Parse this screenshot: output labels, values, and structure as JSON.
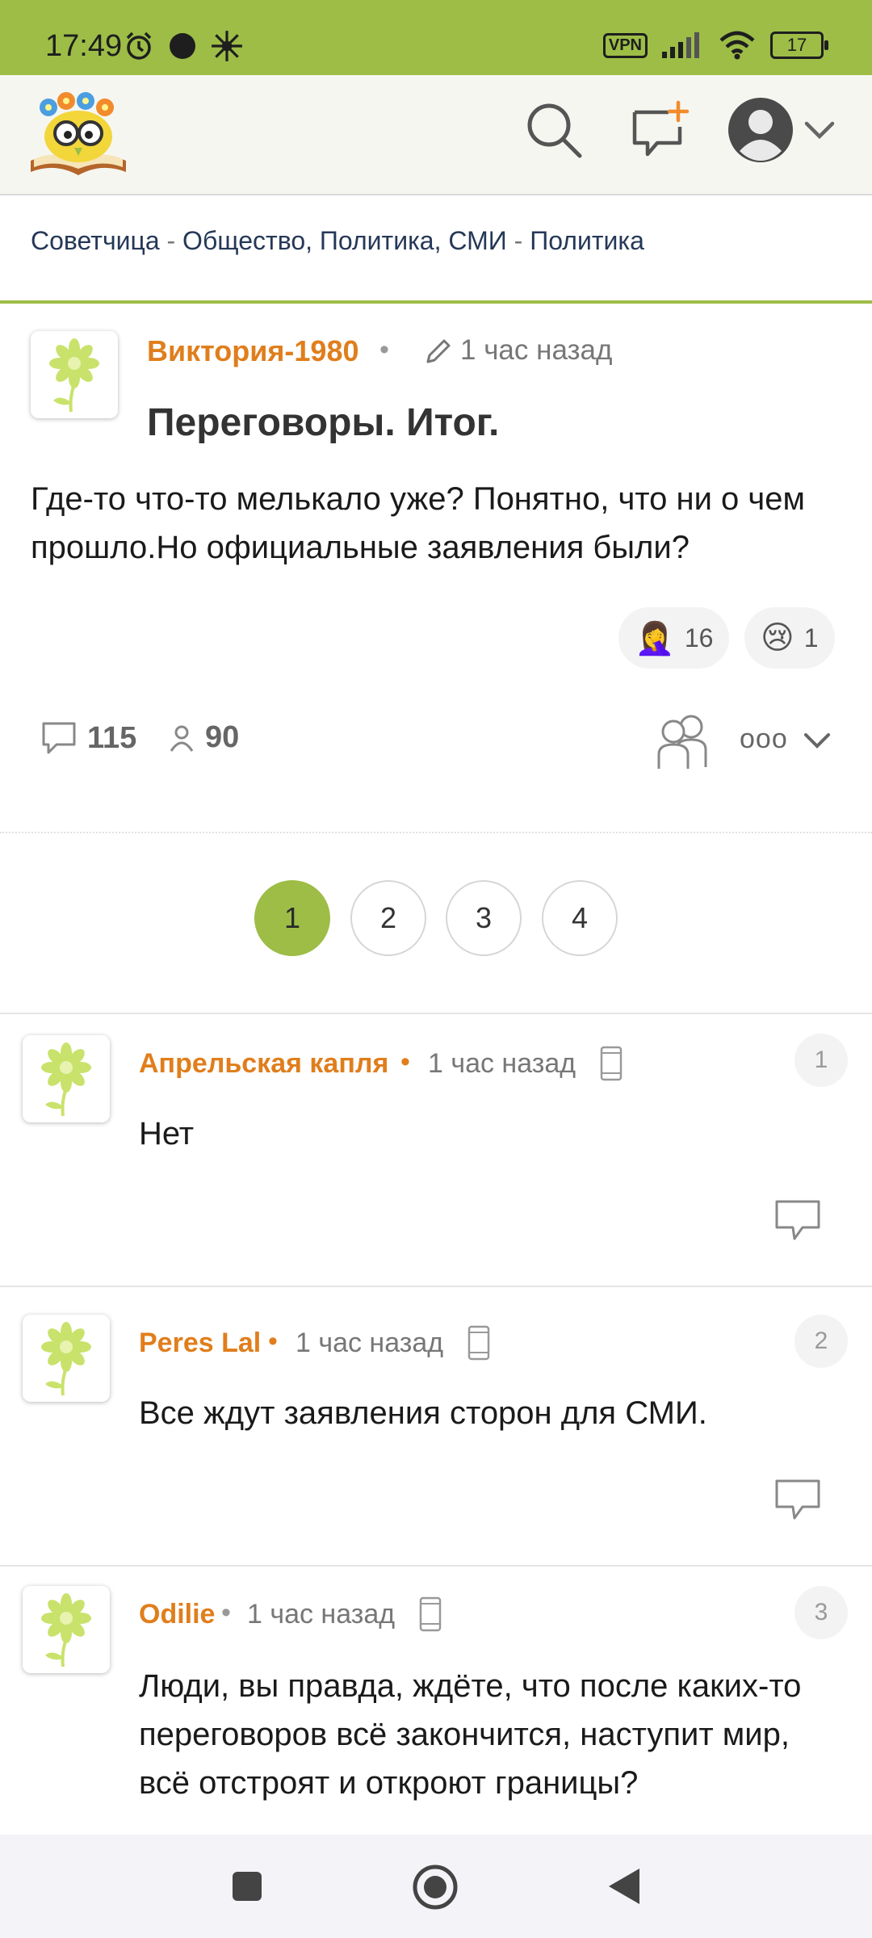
{
  "status_bar": {
    "time": "17:49",
    "vpn": "VPN",
    "battery": "17"
  },
  "header": {
    "logo_icon": "owl-books-logo",
    "search_icon": "search-icon",
    "new_post_icon": "new-post-icon",
    "profile_icon": "user-avatar-icon"
  },
  "breadcrumb": {
    "site": "Советчица",
    "section": "Общество, Политика, СМИ",
    "subsection": "Политика",
    "separator": "-"
  },
  "post": {
    "author": "Виктория-1980",
    "time": "1 час назад",
    "title": "Переговоры. Итог.",
    "body": "Где-то что-то мелькало уже? Понятно, что ни о чем прошло.Но официальные заявления были?",
    "reactions": [
      {
        "emoji": "🤦‍♀️",
        "count": "16"
      },
      {
        "emoji": "😢",
        "count": "1"
      }
    ],
    "comments_count": "115",
    "participants_count": "90",
    "more_label": "ooo"
  },
  "pagination": [
    "1",
    "2",
    "3",
    "4"
  ],
  "comments": [
    {
      "num": "1",
      "author": "Апрельская капля",
      "time": "1 час назад",
      "text": "Нет"
    },
    {
      "num": "2",
      "author": "Peres Lal",
      "time": "1 час назад",
      "text": "Все ждут заявления сторон для СМИ."
    },
    {
      "num": "3",
      "author": "Odilie",
      "time": "1 час назад",
      "text": "Люди, вы правда, ждёте, что после каких-то переговоров всё закончится, наступит мир, всё отстроят и откроют границы?"
    }
  ],
  "colors": {
    "accent": "#9dbd47",
    "author": "#e07e1c"
  }
}
